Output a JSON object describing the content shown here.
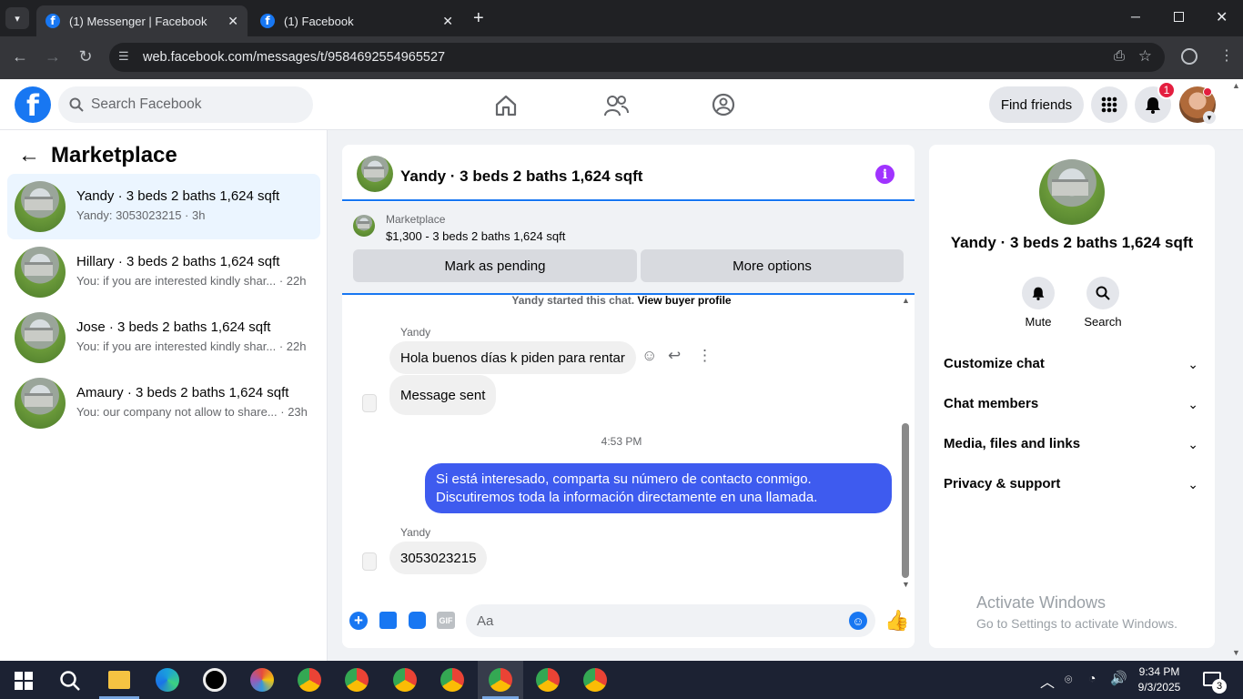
{
  "browser": {
    "tabs": [
      {
        "title": "(1) Messenger | Facebook"
      },
      {
        "title": "(1) Facebook"
      }
    ],
    "url": "web.facebook.com/messages/t/9584692554965527"
  },
  "fbheader": {
    "search_placeholder": "Search Facebook",
    "find_friends": "Find friends",
    "notif_count": "1"
  },
  "sidebar": {
    "title": "Marketplace",
    "conversations": [
      {
        "title": "Yandy · 3 beds 2 baths 1,624 sqft",
        "preview": "Yandy: 3053023215 · 3h"
      },
      {
        "title": "Hillary · 3 beds 2 baths 1,624 sqft",
        "preview": "You: if you are interested kindly shar... · 22h"
      },
      {
        "title": "Jose · 3 beds 2 baths 1,624 sqft",
        "preview": "You: if you are interested kindly shar... · 22h"
      },
      {
        "title": "Amaury · 3 beds 2 baths 1,624 sqft",
        "preview": "You: our company not allow to share... · 23h"
      }
    ]
  },
  "chat": {
    "title": "Yandy · 3 beds 2 baths 1,624 sqft",
    "marketplace_label": "Marketplace",
    "listing": "$1,300 - 3 beds 2 baths 1,624 sqft",
    "btn_pending": "Mark as pending",
    "btn_more": "More options",
    "started_text": "Yandy started this chat.",
    "view_profile": "View buyer profile",
    "sender1": "Yandy",
    "msg1": "Hola buenos días k piden para rentar",
    "msg2": "Message sent",
    "time1": "4:53 PM",
    "msg3_line1": "Si está interesado, comparta su número de contacto conmigo.",
    "msg3_line2": "Discutiremos toda la información directamente en una llamada.",
    "sender2": "Yandy",
    "msg4": "3053023215",
    "composer_placeholder": "Aa"
  },
  "rpanel": {
    "name": "Yandy · 3 beds 2 baths 1,624 sqft",
    "mute": "Mute",
    "search": "Search",
    "sections": [
      "Customize chat",
      "Chat members",
      "Media, files and links",
      "Privacy & support"
    ]
  },
  "watermark": {
    "line1": "Activate Windows",
    "line2": "Go to Settings to activate Windows."
  },
  "taskbar": {
    "time": "9:34 PM",
    "date": "9/3/2025",
    "notif": "3"
  },
  "colors": {
    "fb_blue": "#1877f2",
    "outgoing_bubble": "#3e5bef",
    "taskbar": "#1c2233"
  }
}
